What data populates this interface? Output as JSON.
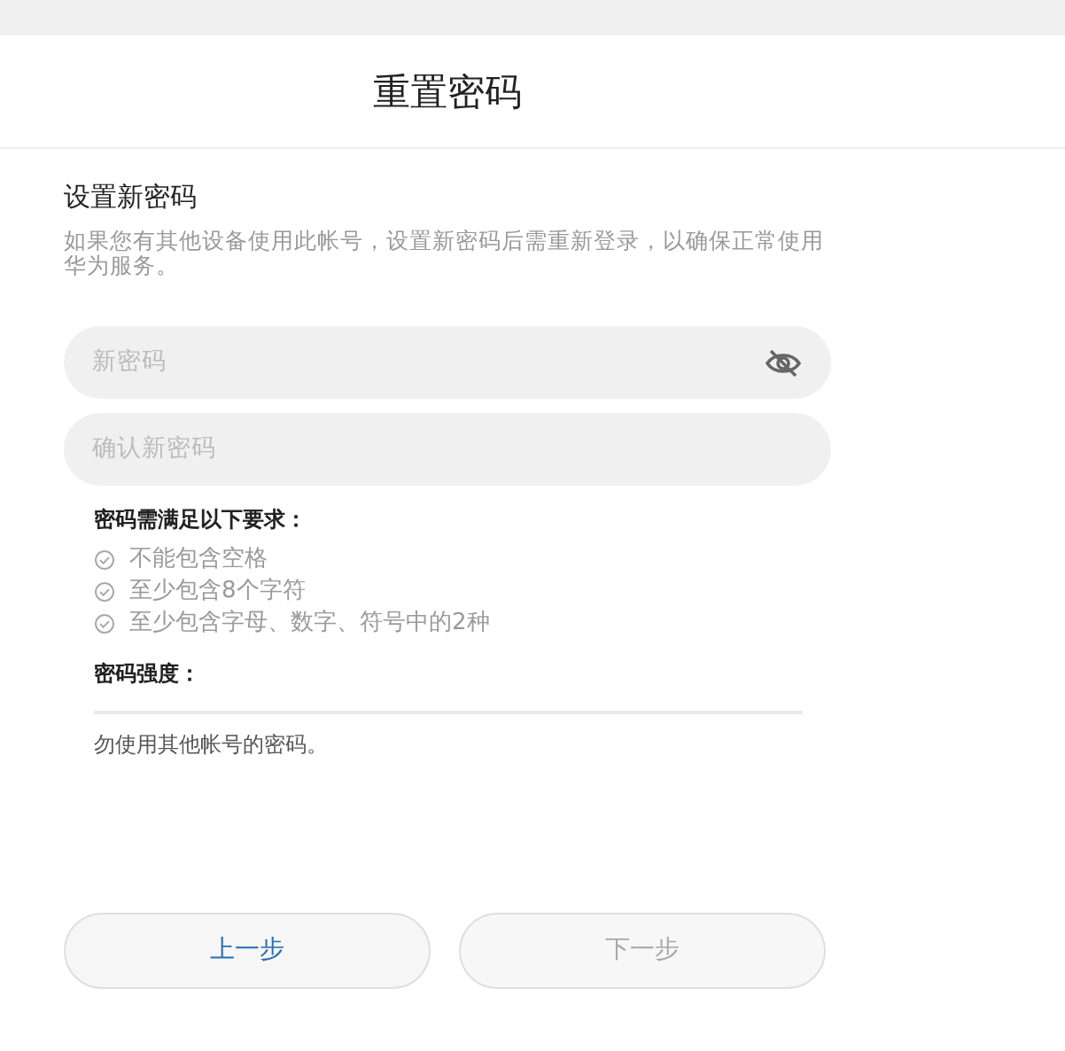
{
  "title": "重置密码",
  "section_title": "设置新密码",
  "description": "如果您有其他设备使用此帐号，设置新密码后需重新登录，以确保正常使用华为服务。",
  "fields": [
    {
      "placeholder": "新密码",
      "kind": "password",
      "password_visible": false
    },
    {
      "placeholder": "确认新密码",
      "kind": "plain"
    }
  ],
  "requirements": {
    "heading": "密码需满足以下要求：",
    "items": [
      {
        "text": "不能包含空格",
        "met": false
      },
      {
        "text": "至少包含8个字符",
        "met": false
      },
      {
        "text": "至少包含字母、数字、符号中的2种",
        "met": false
      }
    ]
  },
  "strength": {
    "label": "密码强度：",
    "level": 0
  },
  "hint": "勿使用其他帐号的密码。",
  "buttons": [
    {
      "label": "上一步",
      "disabled": false
    },
    {
      "label": "下一步",
      "disabled": true
    }
  ]
}
